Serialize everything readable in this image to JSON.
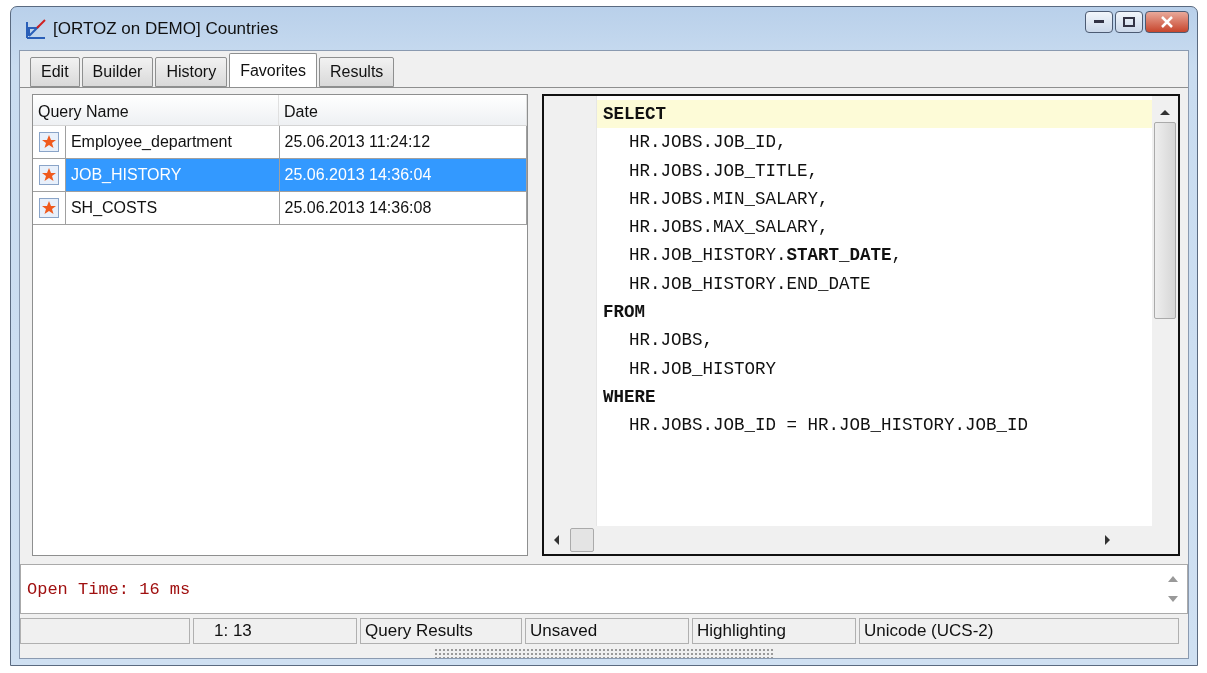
{
  "window": {
    "title": "[ORTOZ on DEMO] Countries"
  },
  "tabs": [
    {
      "label": "Edit",
      "selected": false
    },
    {
      "label": "Builder",
      "selected": false
    },
    {
      "label": "History",
      "selected": false
    },
    {
      "label": "Favorites",
      "selected": true
    },
    {
      "label": "Results",
      "selected": false
    }
  ],
  "favorites": {
    "columns": [
      "Query Name",
      "Date"
    ],
    "rows": [
      {
        "name": "Employee_department",
        "date": "25.06.2013 11:24:12",
        "selected": false
      },
      {
        "name": "JOB_HISTORY",
        "date": "25.06.2013 14:36:04",
        "selected": true
      },
      {
        "name": "SH_COSTS",
        "date": "25.06.2013 14:36:08",
        "selected": false
      }
    ]
  },
  "editor": {
    "lines": [
      {
        "kind": "keyword",
        "text": "SELECT",
        "current": true
      },
      {
        "kind": "item",
        "text": "HR.JOBS.JOB_ID,",
        "current": false
      },
      {
        "kind": "item",
        "text": "HR.JOBS.JOB_TITLE,",
        "current": false
      },
      {
        "kind": "item",
        "text": "HR.JOBS.MIN_SALARY,",
        "current": false
      },
      {
        "kind": "item",
        "text": "HR.JOBS.MAX_SALARY,",
        "current": false
      },
      {
        "kind": "item",
        "text": "HR.JOB_HISTORY.**START_DATE**,",
        "current": false
      },
      {
        "kind": "item",
        "text": "HR.JOB_HISTORY.END_DATE",
        "current": false
      },
      {
        "kind": "keyword",
        "text": "FROM",
        "current": false
      },
      {
        "kind": "item",
        "text": "HR.JOBS,",
        "current": false
      },
      {
        "kind": "item",
        "text": "HR.JOB_HISTORY",
        "current": false
      },
      {
        "kind": "keyword",
        "text": "WHERE",
        "current": false
      },
      {
        "kind": "item",
        "text": "HR.JOBS.JOB_ID = HR.JOB_HISTORY.JOB_ID",
        "current": false
      }
    ]
  },
  "message": "Open Time: 16 ms",
  "status_bar": [
    "1:  13",
    "Query Results",
    "Unsaved",
    "Highlighting",
    "Unicode (UCS-2)"
  ]
}
